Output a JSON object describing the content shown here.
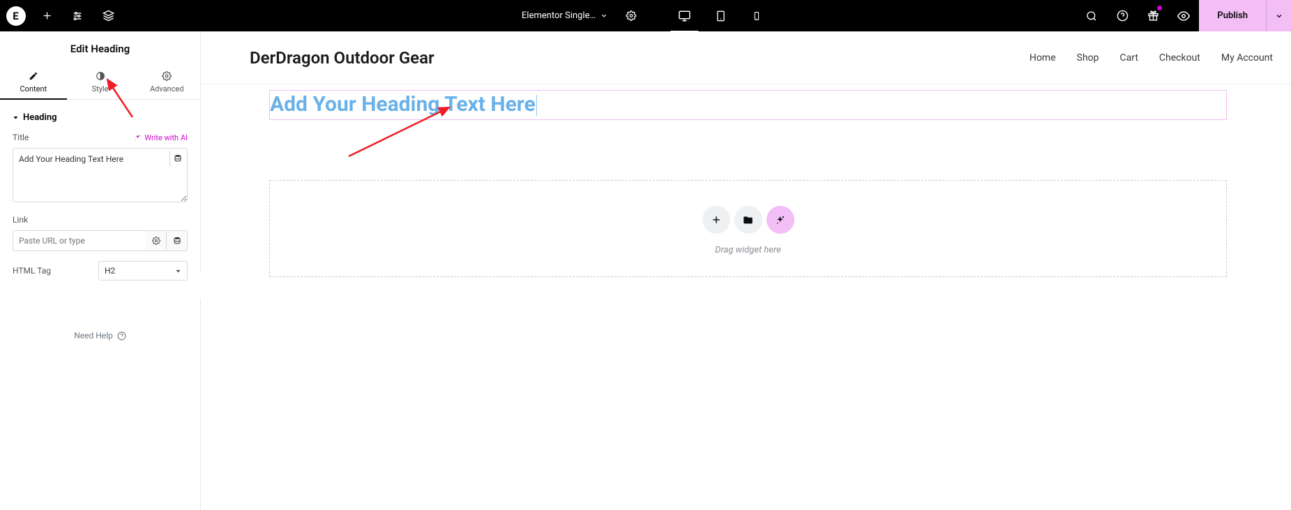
{
  "topbar": {
    "logo_letter": "E",
    "doc_title": "Elementor Single…",
    "publish_label": "Publish"
  },
  "panel": {
    "title": "Edit Heading",
    "tabs": {
      "content": "Content",
      "style": "Style",
      "advanced": "Advanced"
    },
    "section_heading": "Heading",
    "title_label": "Title",
    "write_with_ai": "Write with AI",
    "title_value": "Add Your Heading Text Here",
    "link_label": "Link",
    "link_placeholder": "Paste URL or type",
    "html_tag_label": "HTML Tag",
    "html_tag_value": "H2",
    "need_help": "Need Help"
  },
  "preview": {
    "site_title": "DerDragon Outdoor Gear",
    "nav": {
      "home": "Home",
      "shop": "Shop",
      "cart": "Cart",
      "checkout": "Checkout",
      "account": "My Account"
    },
    "heading_text": "Add Your Heading Text Here",
    "drop_text": "Drag widget here"
  }
}
